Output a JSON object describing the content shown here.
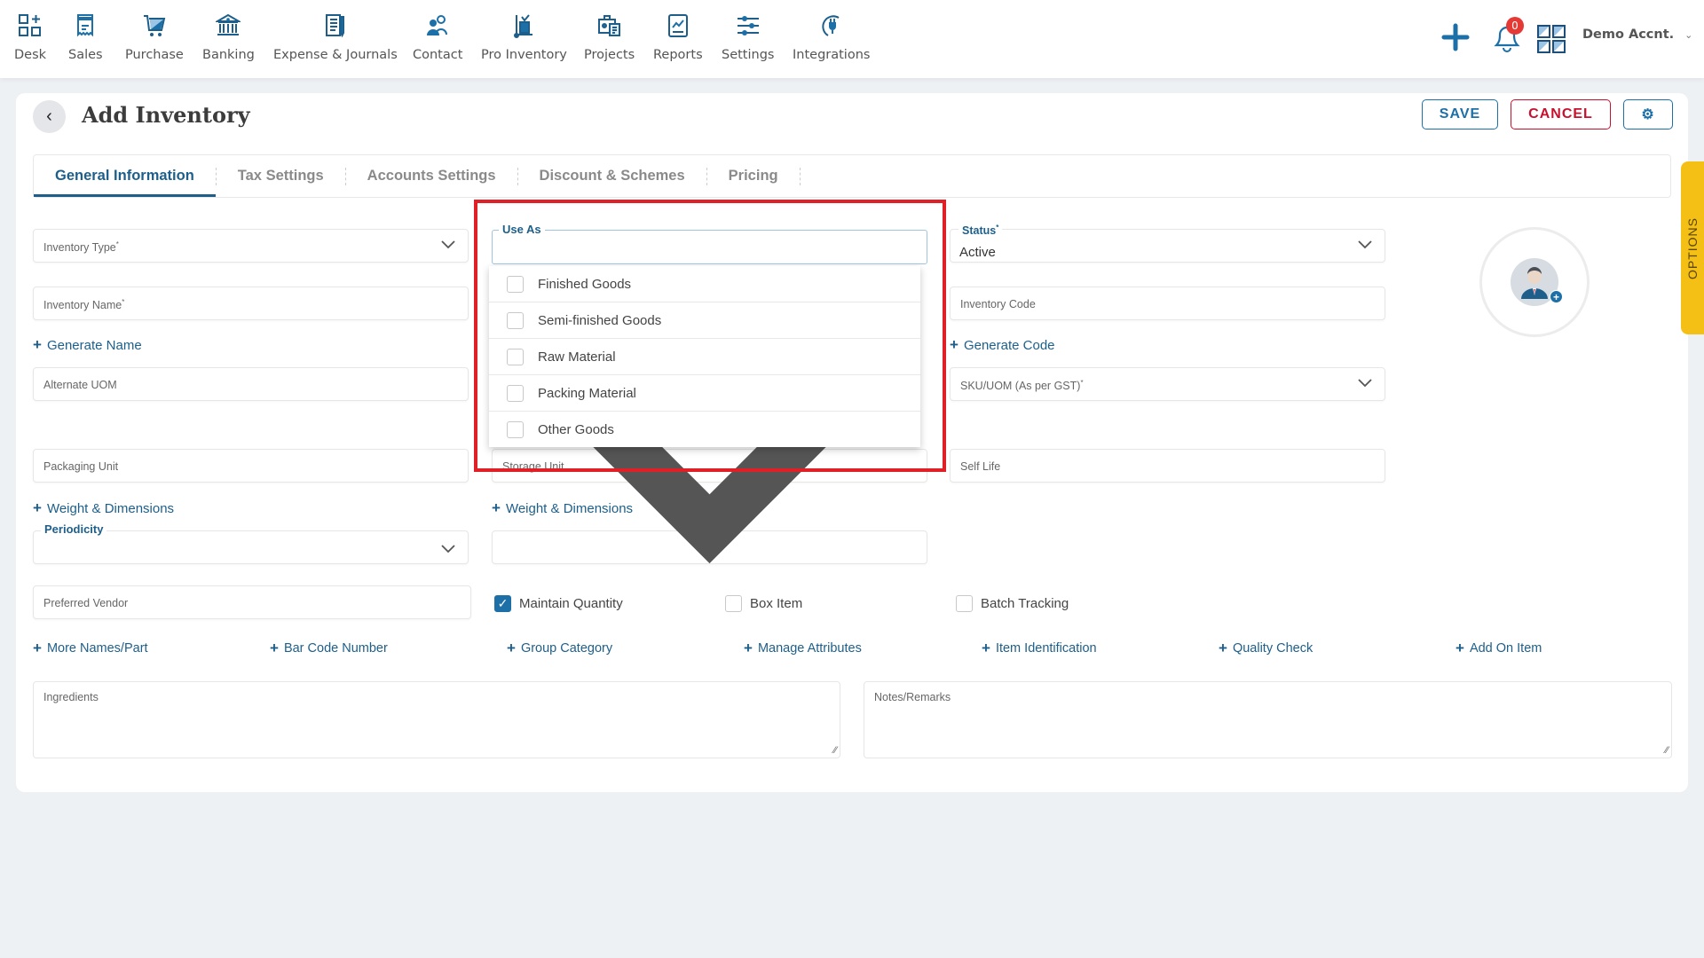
{
  "nav": {
    "items": [
      {
        "label": "Desk",
        "icon": "desk-icon"
      },
      {
        "label": "Sales",
        "icon": "receipt-icon"
      },
      {
        "label": "Purchase",
        "icon": "cart-icon"
      },
      {
        "label": "Banking",
        "icon": "bank-icon"
      },
      {
        "label": "Expense & Journals",
        "icon": "notebook-icon"
      },
      {
        "label": "Contact",
        "icon": "contacts-icon"
      },
      {
        "label": "Pro Inventory",
        "icon": "inventory-trolley-icon"
      },
      {
        "label": "Projects",
        "icon": "briefcase-icon"
      },
      {
        "label": "Reports",
        "icon": "report-chart-icon"
      },
      {
        "label": "Settings",
        "icon": "sliders-icon"
      },
      {
        "label": "Integrations",
        "icon": "plug-icon"
      }
    ],
    "notification_count": "0",
    "account_label": "Demo Accnt.",
    "account_chevron": "⌄"
  },
  "header": {
    "title": "Add Inventory",
    "back_glyph": "‹",
    "save_label": "SAVE",
    "cancel_label": "CANCEL",
    "gear_glyph": "⚙"
  },
  "tabs": [
    {
      "label": "General Information",
      "active": true
    },
    {
      "label": "Tax Settings",
      "active": false
    },
    {
      "label": "Accounts Settings",
      "active": false
    },
    {
      "label": "Discount & Schemes",
      "active": false
    },
    {
      "label": "Pricing",
      "active": false
    }
  ],
  "form": {
    "inventory_type": {
      "label": "Inventory Type",
      "required": "*"
    },
    "inventory_name": {
      "label": "Inventory Name",
      "required": "*"
    },
    "generate_name": "Generate Name",
    "alternate_uom": "Alternate UOM",
    "packaging_unit": "Packaging Unit",
    "weight_dims_1": "Weight & Dimensions",
    "periodicity": "Periodicity",
    "preferred_vendor": "Preferred Vendor",
    "use_as": {
      "label": "Use As",
      "options": [
        {
          "label": "Finished Goods",
          "checked": false
        },
        {
          "label": "Semi-finished Goods",
          "checked": false
        },
        {
          "label": "Raw Material",
          "checked": false
        },
        {
          "label": "Packing Material",
          "checked": false
        },
        {
          "label": "Other Goods",
          "checked": false
        }
      ]
    },
    "storage_unit": "Storage Unit",
    "weight_dims_2": "Weight & Dimensions",
    "status": {
      "label": "Status",
      "required": "*",
      "value": "Active"
    },
    "inventory_code": "Inventory Code",
    "generate_code": "Generate Code",
    "sku_uom": {
      "label": "SKU/UOM (As per GST)",
      "required": "*"
    },
    "self_life": "Self Life",
    "checkboxes": [
      {
        "label": "Maintain Quantity",
        "checked": true
      },
      {
        "label": "Box Item",
        "checked": false
      },
      {
        "label": "Batch Tracking",
        "checked": false
      }
    ],
    "more_links": [
      "More Names/Part",
      "Bar Code Number",
      "Group Category",
      "Manage Attributes",
      "Item Identification",
      "Quality Check",
      "Add On Item"
    ],
    "ingredients": "Ingredients",
    "notes": "Notes/Remarks"
  },
  "side": {
    "options_label": "OPTIONS"
  },
  "colors": {
    "brand_blue": "#1d6fa8",
    "cancel_red": "#c8102e",
    "highlight_red": "#e01f26",
    "options_yellow": "#f5c016"
  }
}
